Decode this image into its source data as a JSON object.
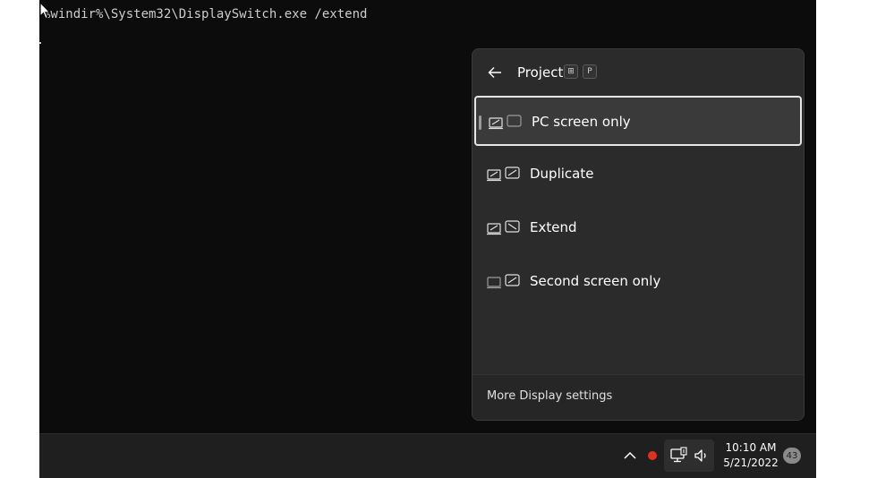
{
  "console": {
    "command": "%windir%\\System32\\DisplaySwitch.exe /extend"
  },
  "project_panel": {
    "title": "Project",
    "shortcut_keys": [
      "⊞",
      "P"
    ],
    "options": [
      {
        "label": "PC screen only",
        "icon": "pc-screen-only-icon",
        "selected": true
      },
      {
        "label": "Duplicate",
        "icon": "duplicate-icon",
        "selected": false
      },
      {
        "label": "Extend",
        "icon": "extend-icon",
        "selected": false
      },
      {
        "label": "Second screen only",
        "icon": "second-screen-only-icon",
        "selected": false
      }
    ],
    "footer_link": "More Display settings"
  },
  "taskbar": {
    "time": "10:10 AM",
    "date": "5/21/2022",
    "notification_count": "43"
  },
  "colors": {
    "console_bg": "#0c0c0c",
    "panel_bg": "#2b2b2b",
    "taskbar_bg": "#1f1f1f",
    "record_dot": "#e0301e"
  }
}
